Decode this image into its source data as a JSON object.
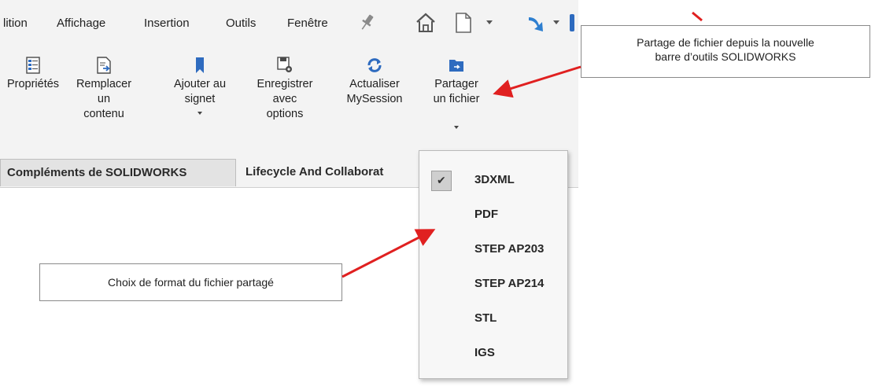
{
  "menubar": {
    "items": [
      "lition",
      "Affichage",
      "Insertion",
      "Outils",
      "Fenêtre"
    ]
  },
  "ribbon": {
    "tools": [
      {
        "label": "Propriétés",
        "icon": "properties-icon"
      },
      {
        "label": "Remplacer\nun\ncontenu",
        "icon": "replace-content-icon"
      },
      {
        "label": "Ajouter au\nsignet",
        "icon": "bookmark-icon"
      },
      {
        "label": "Enregistrer\navec\noptions",
        "icon": "save-options-icon"
      },
      {
        "label": "Actualiser\nMySession",
        "icon": "refresh-icon"
      },
      {
        "label": "Partager\nun fichier",
        "icon": "share-file-icon"
      }
    ]
  },
  "tabs": {
    "complements": "Compléments de SOLIDWORKS",
    "lifecycle": "Lifecycle And Collaborat"
  },
  "dropdown": {
    "items": [
      {
        "label": "3DXML",
        "checked": true
      },
      {
        "label": "PDF",
        "checked": false
      },
      {
        "label": "STEP AP203",
        "checked": false
      },
      {
        "label": "STEP AP214",
        "checked": false
      },
      {
        "label": "STL",
        "checked": false
      },
      {
        "label": "IGS",
        "checked": false
      }
    ]
  },
  "callouts": {
    "share_toolbar": "Partage de fichier depuis la nouvelle\nbarre d’outils SOLIDWORKS",
    "format_choice": "Choix de format du fichier partagé"
  },
  "colors": {
    "annotation_arrow": "#e02020",
    "ribbon_icon_blue": "#2e6bbf",
    "toolbar_bg": "#f3f3f3"
  }
}
